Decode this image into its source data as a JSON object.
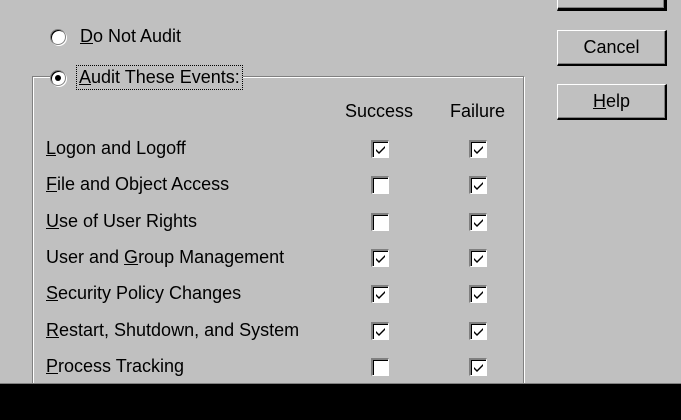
{
  "radios": {
    "do_not_audit": {
      "label_pre": "",
      "label_key": "D",
      "label_post": "o Not Audit",
      "checked": false
    },
    "audit_events": {
      "label_pre": "",
      "label_key": "A",
      "label_post": "udit These Events:",
      "checked": true
    }
  },
  "columns": {
    "success": "Success",
    "failure": "Failure"
  },
  "events": [
    {
      "pre": "",
      "key": "L",
      "post": "ogon and Logoff",
      "success": true,
      "failure": true
    },
    {
      "pre": "",
      "key": "F",
      "post": "ile and Object Access",
      "success": false,
      "failure": true
    },
    {
      "pre": "",
      "key": "U",
      "post": "se of User Rights",
      "success": false,
      "failure": true
    },
    {
      "pre": "User and ",
      "key": "G",
      "post": "roup Management",
      "success": true,
      "failure": true
    },
    {
      "pre": "",
      "key": "S",
      "post": "ecurity Policy Changes",
      "success": true,
      "failure": true
    },
    {
      "pre": "",
      "key": "R",
      "post": "estart, Shutdown, and System",
      "success": true,
      "failure": true
    },
    {
      "pre": "",
      "key": "P",
      "post": "rocess Tracking",
      "success": false,
      "failure": true
    }
  ],
  "buttons": {
    "ok": "",
    "cancel": "Cancel",
    "help_key": "H",
    "help_post": "elp"
  }
}
